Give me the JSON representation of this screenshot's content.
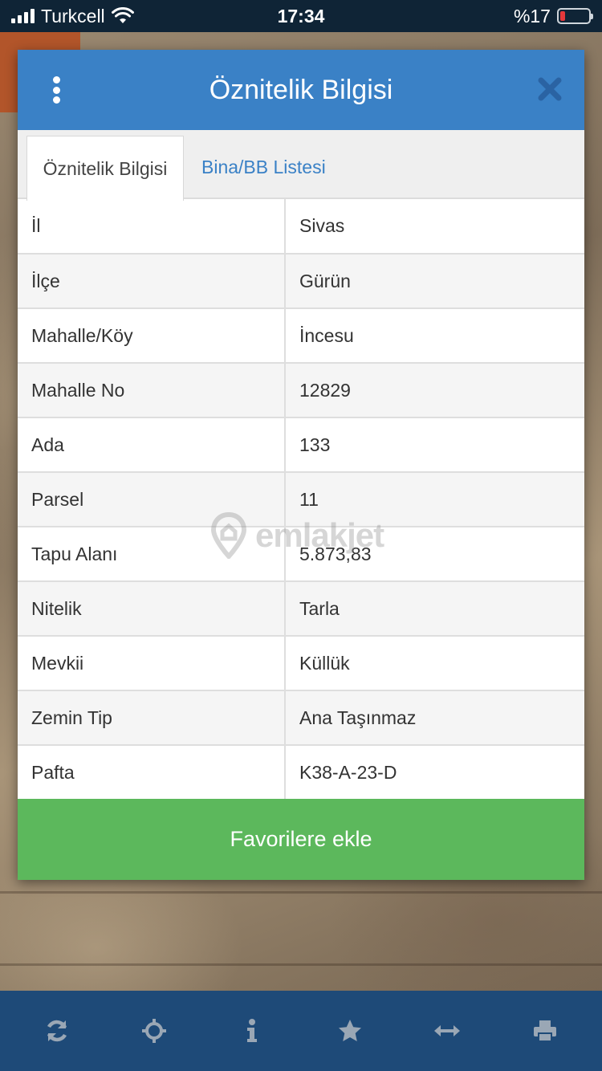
{
  "status_bar": {
    "carrier": "Turkcell",
    "time": "17:34",
    "battery_text": "%17",
    "battery_level_percent": 17
  },
  "modal": {
    "title": "Öznitelik Bilgisi",
    "tabs": [
      {
        "label": "Öznitelik Bilgisi",
        "active": true
      },
      {
        "label": "Bina/BB Listesi",
        "active": false
      }
    ],
    "rows": [
      {
        "key": "İl",
        "value": "Sivas"
      },
      {
        "key": "İlçe",
        "value": "Gürün"
      },
      {
        "key": "Mahalle/Köy",
        "value": "İncesu"
      },
      {
        "key": "Mahalle No",
        "value": "12829"
      },
      {
        "key": "Ada",
        "value": "133"
      },
      {
        "key": "Parsel",
        "value": "11"
      },
      {
        "key": "Tapu Alanı",
        "value": "5.873,83"
      },
      {
        "key": "Nitelik",
        "value": "Tarla"
      },
      {
        "key": "Mevkii",
        "value": "Küllük"
      },
      {
        "key": "Zemin Tip",
        "value": "Ana Taşınmaz"
      },
      {
        "key": "Pafta",
        "value": "K38-A-23-D"
      }
    ],
    "favorite_button_label": "Favorilere ekle"
  },
  "watermark": {
    "text": "emlakjet"
  },
  "bottom_bar": {
    "icons": [
      "refresh-icon",
      "crosshair-icon",
      "info-icon",
      "star-icon",
      "measure-icon",
      "print-icon"
    ]
  },
  "colors": {
    "header_blue": "#3a81c6",
    "button_green": "#5cb85c",
    "bottom_bar": "#1e4a78",
    "status_bar": "#0f2436",
    "battery_low": "#e5383b"
  }
}
